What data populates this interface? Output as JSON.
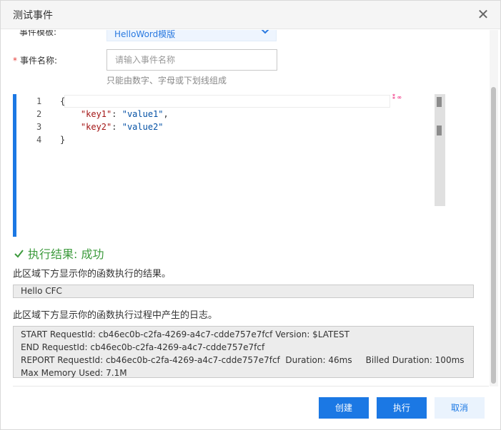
{
  "dialog": {
    "title": "测试事件",
    "close_icon": "close-icon"
  },
  "form": {
    "template_label": "事件模板:",
    "template_value": "HelloWord模版",
    "name_required_mark": "*",
    "name_label": "事件名称:",
    "name_placeholder": "请输入事件名称",
    "name_value": "",
    "name_hint": "只能由数字、字母或下划线组成"
  },
  "editor": {
    "line_numbers": [
      "1",
      "2",
      "3",
      "4"
    ],
    "lines": [
      {
        "text": "{"
      },
      {
        "key": "\"key1\"",
        "sep": ": ",
        "value": "\"value1\"",
        "tail": ","
      },
      {
        "key": "\"key2\"",
        "sep": ": ",
        "value": "\"value2\"",
        "tail": ""
      },
      {
        "text": "}"
      }
    ]
  },
  "result": {
    "status": "执行结果: 成功",
    "status_color": "#3c9a3c",
    "output_desc": "此区域下方显示你的函数执行的结果。",
    "output": "Hello CFC",
    "log_desc": "此区域下方显示你的函数执行过程中产生的日志。",
    "log_lines": [
      "START RequestId: cb46ec0b-c2fa-4269-a4c7-cdde757e7fcf Version: $LATEST",
      "END RequestId: cb46ec0b-c2fa-4269-a4c7-cdde757e7fcf",
      "REPORT RequestId: cb46ec0b-c2fa-4269-a4c7-cdde757e7fcf  Duration: 46ms     Billed Duration: 100ms Max Memory Used: 7.1M"
    ]
  },
  "footer": {
    "create_label": "创建",
    "run_label": "执行",
    "cancel_label": "取消"
  },
  "colors": {
    "primary": "#1b78e4",
    "success": "#3c9a3c",
    "required": "#e6403c"
  }
}
